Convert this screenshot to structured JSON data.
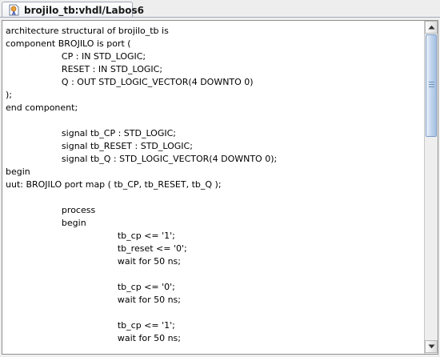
{
  "tab": {
    "icon": "vhdl-file-icon",
    "title": "brojilo_tb:vhdl/Labos6"
  },
  "editor": {
    "lines": [
      "architecture structural of brojilo_tb is",
      "component BROJILO is port (",
      "                    CP : IN STD_LOGIC;",
      "                    RESET : IN STD_LOGIC;",
      "                    Q : OUT STD_LOGIC_VECTOR(4 DOWNTO 0)",
      ");",
      "end component;",
      "",
      "                    signal tb_CP : STD_LOGIC;",
      "                    signal tb_RESET : STD_LOGIC;",
      "                    signal tb_Q : STD_LOGIC_VECTOR(4 DOWNTO 0);",
      "begin",
      "uut: BROJILO port map ( tb_CP, tb_RESET, tb_Q );",
      "",
      "                    process",
      "                    begin",
      "                                        tb_cp <= '1';",
      "                                        tb_reset <= '0';",
      "                                        wait for 50 ns;",
      "",
      "                                        tb_cp <= '0';",
      "                                        wait for 50 ns;",
      "",
      "                                        tb_cp <= '1';",
      "                                        wait for 50 ns;"
    ]
  },
  "scrollbar": {
    "up_icon": "arrow-up-icon",
    "down_icon": "arrow-down-icon"
  }
}
